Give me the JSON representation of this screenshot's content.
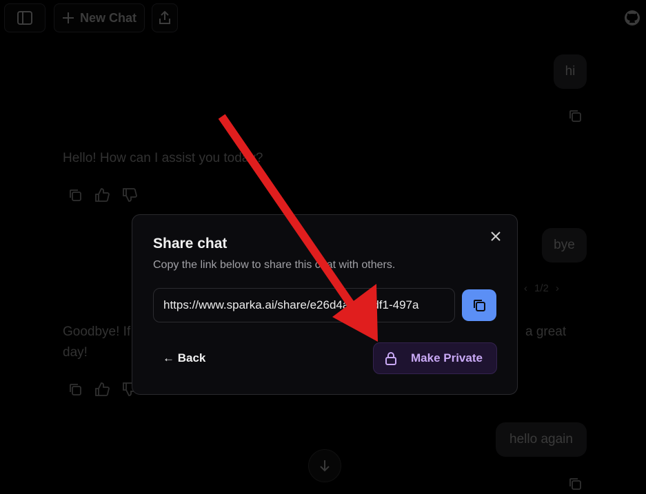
{
  "topbar": {
    "new_chat_label": "New Chat",
    "icons": [
      "sidebar-icon",
      "plus-icon",
      "share-icon",
      "github-icon"
    ]
  },
  "conversation": {
    "user_messages": [
      "hi",
      "bye",
      "hello again"
    ],
    "assistant_messages": [
      "Hello! How can I assist you today?",
      "Goodbye! If",
      "a great",
      "day!"
    ],
    "pager": "1/2"
  },
  "modal": {
    "title": "Share chat",
    "description": "Copy the link below to share this chat with others.",
    "url_value": "https://www.sparka.ai/share/e26d4a3e-6df1-497a",
    "back_label": "← Back",
    "make_private_label": "Make Private"
  },
  "colors": {
    "accent_blue": "#5b8ff5",
    "private_purple": "#c9a9f5",
    "annotation_red": "#e01e1e"
  }
}
